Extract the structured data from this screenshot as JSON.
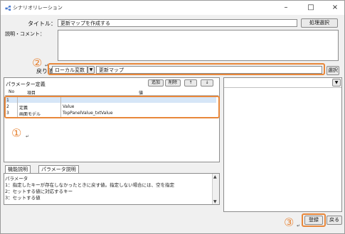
{
  "window": {
    "title": "シナリオリレーション",
    "controls": {
      "minimize": "–",
      "maximize": "□",
      "close": "×"
    }
  },
  "form": {
    "title_label": "タイトル：",
    "title_value": "更新マップを作成する",
    "select_process_button": "処理選択",
    "desc_label": "説明・コメント：",
    "desc_value": "",
    "return_label": "戻り値：",
    "return_type": "ローカル変数",
    "return_value": "更新マップ",
    "select_button": "選択"
  },
  "params": {
    "header": "パラメーター定義",
    "buttons": {
      "add": "追加",
      "delete": "削除",
      "up": "↑",
      "down": "↓"
    },
    "columns": {
      "no": "No",
      "item": "項目",
      "value": "値"
    },
    "rows": [
      {
        "no": "1",
        "item": "",
        "value": ""
      },
      {
        "no": "2",
        "item": "定義",
        "value": "Value"
      },
      {
        "no": "3",
        "item": "画面モデル",
        "value": "TopPanelValue_txtValue"
      }
    ]
  },
  "tabs": {
    "function_desc": "機能説明",
    "param_desc": "パラメータ説明"
  },
  "param_description": [
    "パラメータ",
    "  1：指定したキーが存在しなかったときに戻す値。指定しない場合には、空を指定",
    "  2：セットする値に対応するキー",
    "  3：セットする値"
  ],
  "footer": {
    "register_button": "登録",
    "back_button": "戻る"
  },
  "annotations": {
    "n1": "①",
    "n2": "②",
    "n3": "③"
  },
  "colors": {
    "accent": "#e8873a",
    "selection": "#d6e6f7",
    "window_bg": "#f0f0f0"
  }
}
